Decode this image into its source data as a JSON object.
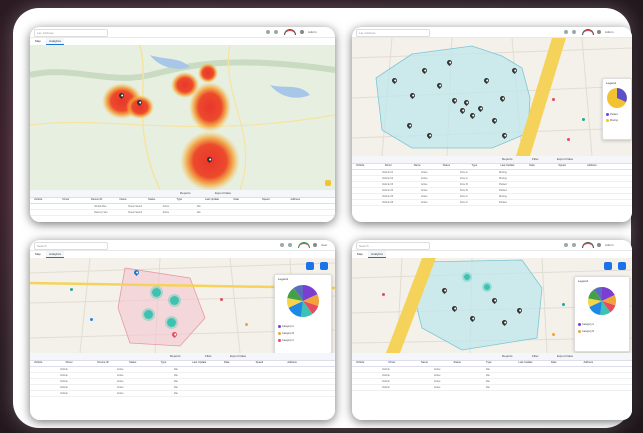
{
  "colors": {
    "background": "#2a1a22",
    "card": "#ffffff",
    "accent": "#1976d2",
    "heat_red": "#e8362c",
    "heat_yellow": "#f5c342",
    "zone_fill": "#bfe6ec",
    "zone_fill_pink": "#f3c6cf",
    "road": "#f5d35a",
    "cluster": "#3cc2b0"
  },
  "screenshots": [
    {
      "name": "heatmap-view",
      "search": {
        "placeholder": "Lat, Address"
      },
      "user": "Admin",
      "tabs": [
        {
          "label": "Map",
          "active": false
        },
        {
          "label": "Analytics",
          "active": true
        }
      ],
      "toolbar": {
        "reports_label": "Reports",
        "export_label": "Export Data"
      },
      "columns": [
        "Vehicle",
        "Driver",
        "Device ID",
        "Name",
        "Status",
        "Type",
        "Last Update",
        "Date",
        "Speed",
        "Address"
      ],
      "rows": [
        [
          "",
          "Shuttle Bus",
          "Route Sector",
          "Active",
          "Idle"
        ],
        [
          "",
          "Delivery Van",
          "Route Sector",
          "Active",
          "Idle"
        ]
      ]
    },
    {
      "name": "pins-zone-view",
      "search": {
        "placeholder": "Lat, Address"
      },
      "user": "Admin",
      "toolbar": {
        "reports_label": "Reports",
        "filter_label": "Filter",
        "export_label": "Export Data"
      },
      "legend": {
        "title": "Legend",
        "items": [
          {
            "label": "Parked",
            "color": "#5b4fcf"
          },
          {
            "label": "Moving",
            "color": "#f2c230"
          }
        ]
      },
      "columns": [
        "Vehicle",
        "Driver",
        "Name",
        "Status",
        "Type",
        "Last Update",
        "Date",
        "Speed",
        "Address"
      ],
      "rows": [
        [
          "Vehicle 01",
          "Active",
          "Zone A",
          "Moving"
        ],
        [
          "Vehicle 02",
          "Active",
          "Zone A",
          "Moving"
        ],
        [
          "Vehicle 03",
          "Active",
          "Zone B",
          "Parked"
        ],
        [
          "Vehicle 04",
          "Active",
          "Zone B",
          "Parked"
        ],
        [
          "Vehicle 05",
          "Active",
          "Zone C",
          "Moving"
        ],
        [
          "Vehicle 06",
          "Active",
          "Zone C",
          "Parked"
        ]
      ]
    },
    {
      "name": "cluster-view",
      "search": {
        "placeholder": "Search"
      },
      "user": "User",
      "tabs": [
        {
          "label": "Map",
          "active": false
        },
        {
          "label": "Analytics",
          "active": true
        }
      ],
      "toolbar": {
        "reports_label": "Reports",
        "filter_label": "Filter",
        "export_label": "Export Data"
      },
      "legend": {
        "title": "Legend",
        "items": [
          {
            "label": "Category A",
            "color": "#7a3fd1"
          },
          {
            "label": "Category B",
            "color": "#f2a33a"
          },
          {
            "label": "Category C",
            "color": "#e84a5f"
          }
        ]
      },
      "columns": [
        "Vehicle",
        "Driver",
        "Device ID",
        "Status",
        "Type",
        "Last Update",
        "Date",
        "Speed",
        "Address"
      ],
      "rows": [
        [
          "Vehicle",
          "Active",
          "Idle"
        ],
        [
          "Vehicle",
          "Active",
          "Idle"
        ],
        [
          "Vehicle",
          "Active",
          "Idle"
        ],
        [
          "Vehicle",
          "Active",
          "Idle"
        ],
        [
          "Vehicle",
          "Active",
          "Idle"
        ]
      ]
    },
    {
      "name": "zone-cluster-view",
      "search": {
        "placeholder": "Search"
      },
      "user": "Admin",
      "tabs": [
        {
          "label": "Map",
          "active": false
        },
        {
          "label": "Analytics",
          "active": true
        }
      ],
      "toolbar": {
        "reports_label": "Reports",
        "filter_label": "Filter",
        "export_label": "Export Data"
      },
      "legend": {
        "title": "Legend",
        "items": [
          {
            "label": "Category A",
            "color": "#7a3fd1"
          },
          {
            "label": "Category B",
            "color": "#f2a33a"
          }
        ]
      },
      "columns": [
        "Vehicle",
        "Driver",
        "Name",
        "Status",
        "Type",
        "Last Update",
        "Date",
        "Address"
      ],
      "rows": [
        [
          "Vehicle",
          "Active",
          "Idle"
        ],
        [
          "Vehicle",
          "Active",
          "Idle"
        ],
        [
          "Vehicle",
          "Active",
          "Idle"
        ],
        [
          "Vehicle",
          "Active",
          "Idle"
        ]
      ]
    }
  ],
  "pie_segments": [
    {
      "color": "#7a3fd1",
      "value": 0.18
    },
    {
      "color": "#f2a33a",
      "value": 0.12
    },
    {
      "color": "#e84a5f",
      "value": 0.1
    },
    {
      "color": "#3cc2b0",
      "value": 0.12
    },
    {
      "color": "#1e88e5",
      "value": 0.16
    },
    {
      "color": "#f6d44a",
      "value": 0.1
    },
    {
      "color": "#43a047",
      "value": 0.12
    },
    {
      "color": "#5c6bc0",
      "value": 0.1
    }
  ]
}
